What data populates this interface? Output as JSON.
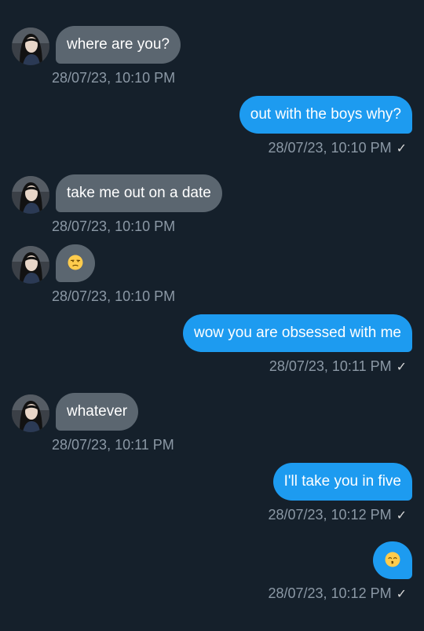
{
  "messages": [
    {
      "dir": "in",
      "text": "where are you?",
      "time": "28/07/23, 10:10 PM"
    },
    {
      "dir": "out",
      "text": "out with the boys why?",
      "time": "28/07/23, 10:10 PM",
      "status": "✓"
    },
    {
      "dir": "in",
      "text": "take me out on a date",
      "time": "28/07/23, 10:10 PM"
    },
    {
      "dir": "in",
      "emoji": "unamused-face-emoji",
      "time": "28/07/23, 10:10 PM"
    },
    {
      "dir": "out",
      "text": "wow you are obsessed with me",
      "time": "28/07/23, 10:11 PM",
      "status": "✓"
    },
    {
      "dir": "in",
      "text": "whatever",
      "time": "28/07/23, 10:11 PM"
    },
    {
      "dir": "out",
      "text": "I'll take you in five",
      "time": "28/07/23, 10:12 PM",
      "status": "✓"
    },
    {
      "dir": "out",
      "emoji": "kissing-face-emoji",
      "time": "28/07/23, 10:12 PM",
      "status": "✓"
    }
  ],
  "colors": {
    "background": "#15202b",
    "incoming_bubble": "#5b6670",
    "outgoing_bubble": "#1d9bf0",
    "timestamp": "#8b98a5"
  }
}
